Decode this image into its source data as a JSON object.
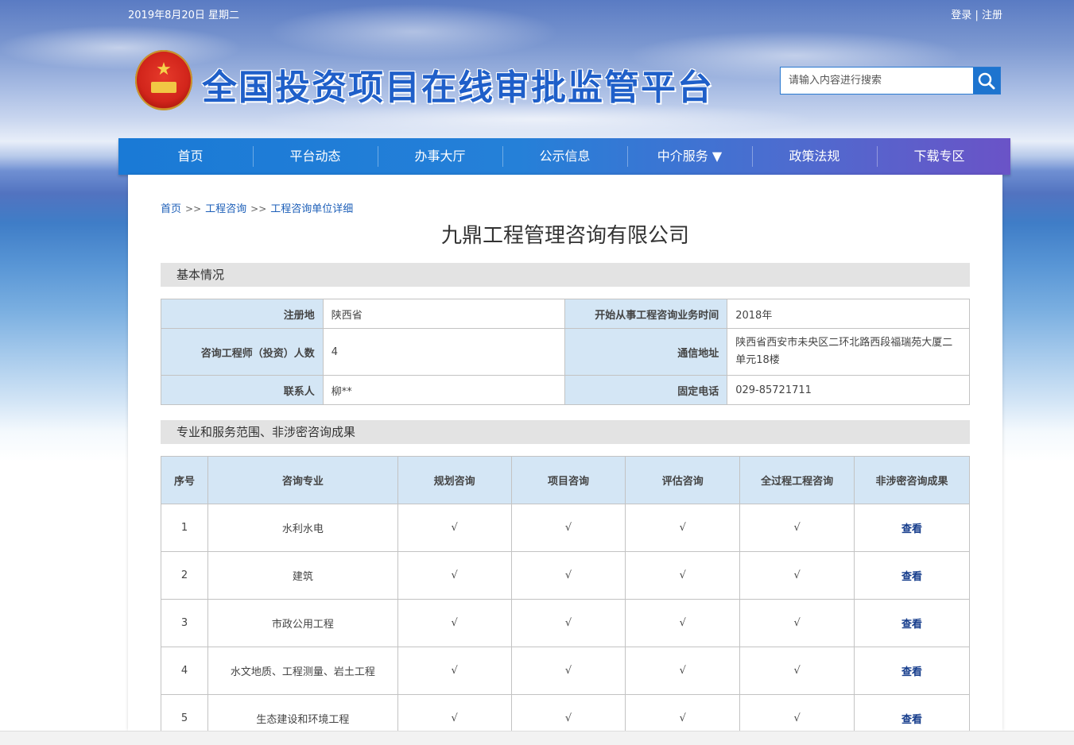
{
  "topbar": {
    "date": "2019年8月20日 星期二",
    "login": "登录",
    "divider": "|",
    "register": "注册"
  },
  "header": {
    "site_title": "全国投资项目在线审批监管平台",
    "emblem_icon": "national-emblem-icon"
  },
  "search": {
    "placeholder": "请输入内容进行搜索",
    "icon": "search-icon"
  },
  "nav": [
    {
      "label": "首页"
    },
    {
      "label": "平台动态"
    },
    {
      "label": "办事大厅"
    },
    {
      "label": "公示信息"
    },
    {
      "label": "中介服务 ▼"
    },
    {
      "label": "政策法规"
    },
    {
      "label": "下载专区"
    }
  ],
  "breadcrumb": {
    "home": "首页",
    "sep": ">>",
    "level1": "工程咨询",
    "level2": "工程咨询单位详细"
  },
  "company_name": "九鼎工程管理咨询有限公司",
  "basic": {
    "title": "基本情况",
    "reg_label": "注册地",
    "reg_value": "陕西省",
    "start_label": "开始从事工程咨询业务时间",
    "start_value": "2018年",
    "eng_label": "咨询工程师（投资）人数",
    "eng_value": "4",
    "addr_label": "通信地址",
    "addr_value": "陕西省西安市未央区二环北路西段福瑞苑大厦二单元18楼",
    "contact_label": "联系人",
    "contact_value": "柳**",
    "phone_label": "固定电话",
    "phone_value": "029-85721711"
  },
  "scope": {
    "title": "专业和服务范围、非涉密咨询成果",
    "headers": [
      "序号",
      "咨询专业",
      "规划咨询",
      "项目咨询",
      "评估咨询",
      "全过程工程咨询",
      "非涉密咨询成果"
    ],
    "rows": [
      {
        "no": "1",
        "major": "水利水电",
        "plan": "√",
        "project": "√",
        "assess": "√",
        "whole": "√",
        "view": "查看"
      },
      {
        "no": "2",
        "major": "建筑",
        "plan": "√",
        "project": "√",
        "assess": "√",
        "whole": "√",
        "view": "查看"
      },
      {
        "no": "3",
        "major": "市政公用工程",
        "plan": "√",
        "project": "√",
        "assess": "√",
        "whole": "√",
        "view": "查看"
      },
      {
        "no": "4",
        "major": "水文地质、工程测量、岩土工程",
        "plan": "√",
        "project": "√",
        "assess": "√",
        "whole": "√",
        "view": "查看"
      },
      {
        "no": "5",
        "major": "生态建设和环境工程",
        "plan": "√",
        "project": "√",
        "assess": "√",
        "whole": "√",
        "view": "查看"
      }
    ]
  }
}
